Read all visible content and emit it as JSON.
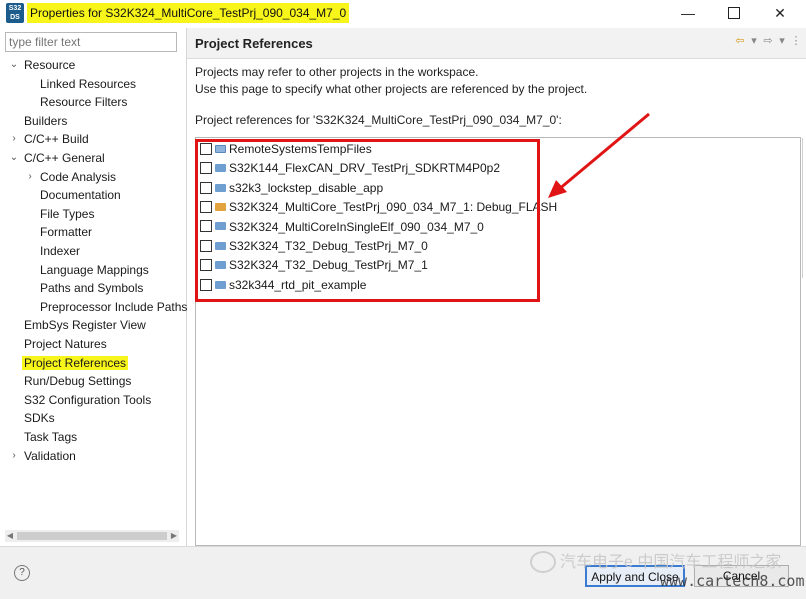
{
  "window": {
    "app_icon_text": "S32\nDS",
    "title": "Properties for S32K324_MultiCore_TestPrj_090_034_M7_0",
    "minimize_glyph": "—",
    "close_glyph": "✕"
  },
  "filter": {
    "placeholder": "type filter text"
  },
  "tree": [
    {
      "label": "Resource",
      "expander": "⌄"
    },
    {
      "label": "Linked Resources"
    },
    {
      "label": "Resource Filters"
    },
    {
      "label": "Builders"
    },
    {
      "label": "C/C++ Build",
      "expander": "›"
    },
    {
      "label": "C/C++ General",
      "expander": "⌄"
    },
    {
      "label": "Code Analysis",
      "expander": "›"
    },
    {
      "label": "Documentation"
    },
    {
      "label": "File Types"
    },
    {
      "label": "Formatter"
    },
    {
      "label": "Indexer"
    },
    {
      "label": "Language Mappings"
    },
    {
      "label": "Paths and Symbols"
    },
    {
      "label": "Preprocessor Include Paths"
    },
    {
      "label": "EmbSys Register View"
    },
    {
      "label": "Project Natures"
    },
    {
      "label": "Project References",
      "selected": true
    },
    {
      "label": "Run/Debug Settings"
    },
    {
      "label": "S32 Configuration Tools"
    },
    {
      "label": "SDKs"
    },
    {
      "label": "Task Tags"
    },
    {
      "label": "Validation",
      "expander": "›"
    }
  ],
  "page": {
    "title": "Project References",
    "nav_icons": [
      "⇦",
      "▾",
      "⇨",
      "▾",
      "⋮"
    ],
    "description_line1": "Projects may refer to other projects in the workspace.",
    "description_line2": "Use this page to specify what other projects are referenced by the project.",
    "refs_label": "Project references for 'S32K324_MultiCore_TestPrj_090_034_M7_0':",
    "projects": [
      {
        "name": "RemoteSystemsTempFiles",
        "icon": "folder-open-icon",
        "checked": false
      },
      {
        "name": "S32K144_FlexCAN_DRV_TestPrj_SDKRTM4P0p2",
        "icon": "project-folder-icon",
        "checked": false
      },
      {
        "name": "s32k3_lockstep_disable_app",
        "icon": "project-folder-icon",
        "checked": false
      },
      {
        "name": "S32K324_MultiCore_TestPrj_090_034_M7_1: Debug_FLASH",
        "icon": "project-special-icon",
        "checked": false
      },
      {
        "name": "S32K324_MultiCoreInSingleElf_090_034_M7_0",
        "icon": "project-folder-icon",
        "checked": false
      },
      {
        "name": "S32K324_T32_Debug_TestPrj_M7_0",
        "icon": "project-folder-icon",
        "checked": false
      },
      {
        "name": "S32K324_T32_Debug_TestPrj_M7_1",
        "icon": "project-folder-icon",
        "checked": false
      },
      {
        "name": "s32k344_rtd_pit_example",
        "icon": "project-folder-icon",
        "checked": false
      }
    ]
  },
  "footer": {
    "help": "?",
    "apply_close": "Apply and Close",
    "cancel": "Cancel"
  },
  "watermark": {
    "text": "汽车电子e 中国汽车工程师之家",
    "url": "www.cartech8.com"
  },
  "colors": {
    "highlight": "#f8f51a",
    "annotation_red": "#e01414",
    "accent": "#3b7bd1"
  }
}
